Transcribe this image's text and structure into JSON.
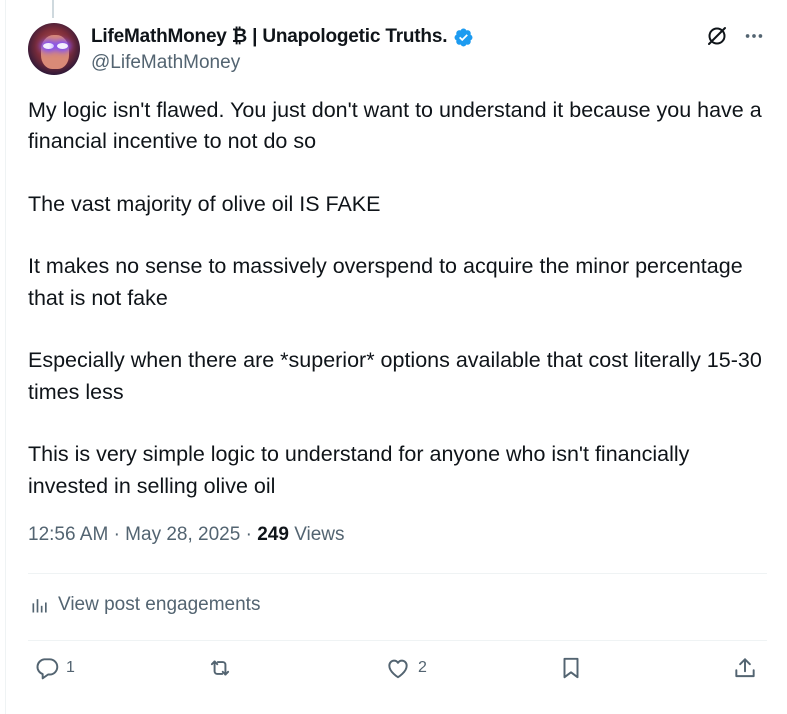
{
  "author": {
    "display_name": "LifeMathMoney ₿ | Unapologetic Truths.",
    "handle": "@LifeMathMoney",
    "verified": true,
    "verified_color": "#1d9bf0"
  },
  "post": {
    "paragraphs": [
      "My logic isn't flawed. You just don't want to understand it because you have a financial incentive to not do so",
      "The vast majority of olive oil IS FAKE",
      "It makes no sense to massively overspend to acquire the minor percentage that is not fake",
      "Especially when there are *superior* options available that cost literally 15-30 times less",
      "This is very simple logic to understand for anyone who isn't financially invested in selling olive oil"
    ],
    "time": "12:56 AM",
    "separator": "·",
    "date": "May 28, 2025",
    "views_count": "249",
    "views_label": "Views"
  },
  "engagements_link": "View post engagements",
  "actions": {
    "reply_count": "1",
    "retweet_count": "",
    "like_count": "2"
  },
  "icons": [
    "grok-icon",
    "more-icon",
    "analytics-icon",
    "reply-icon",
    "retweet-icon",
    "like-icon",
    "bookmark-icon",
    "share-icon"
  ],
  "colors": {
    "text": "#0f1419",
    "muted": "#536471",
    "divider": "#eff3f4",
    "accent": "#1d9bf0"
  }
}
